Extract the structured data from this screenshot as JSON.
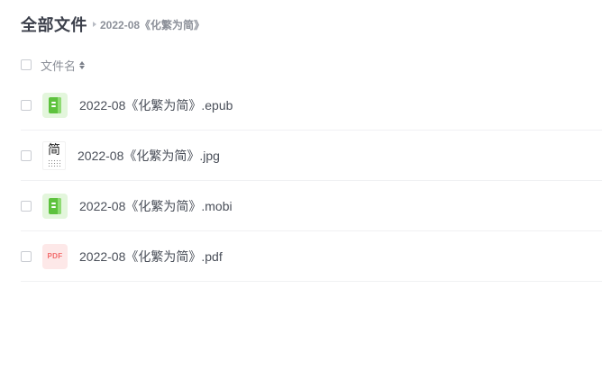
{
  "header": {
    "title": "全部文件",
    "breadcrumb": "2022-08《化繁为简》"
  },
  "list_header": {
    "column_name": "文件名",
    "sort_icon": "sort-updown-icon"
  },
  "files": [
    {
      "name": "2022-08《化繁为简》.epub",
      "type": "epub",
      "icon": "ebook-icon"
    },
    {
      "name": "2022-08《化繁为简》.jpg",
      "type": "jpg",
      "icon": "image-thumbnail",
      "thumb_glyph": "简"
    },
    {
      "name": "2022-08《化繁为简》.mobi",
      "type": "mobi",
      "icon": "ebook-icon"
    },
    {
      "name": "2022-08《化繁为简》.pdf",
      "type": "pdf",
      "icon": "pdf-icon",
      "icon_text": "PDF"
    }
  ],
  "colors": {
    "ebook_icon": "#5dc23d",
    "ebook_bg": "#e3f6dc",
    "pdf_icon": "#f26b6b",
    "pdf_bg": "#fde8e8"
  }
}
